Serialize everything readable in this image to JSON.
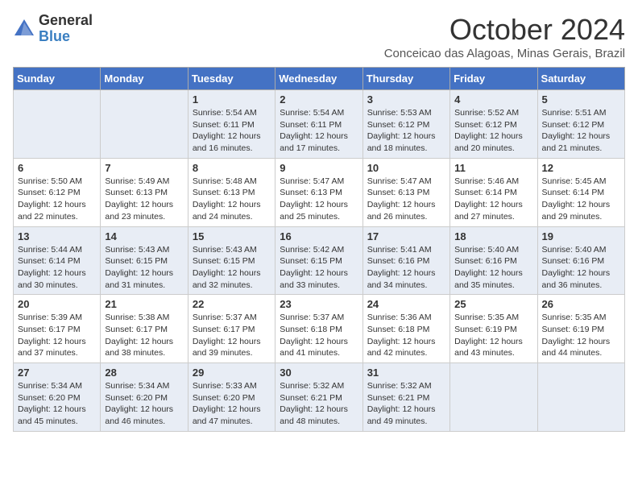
{
  "logo": {
    "general": "General",
    "blue": "Blue"
  },
  "title": "October 2024",
  "location": "Conceicao das Alagoas, Minas Gerais, Brazil",
  "days_of_week": [
    "Sunday",
    "Monday",
    "Tuesday",
    "Wednesday",
    "Thursday",
    "Friday",
    "Saturday"
  ],
  "weeks": [
    [
      {
        "day": "",
        "info": ""
      },
      {
        "day": "",
        "info": ""
      },
      {
        "day": "1",
        "info": "Sunrise: 5:54 AM\nSunset: 6:11 PM\nDaylight: 12 hours and 16 minutes."
      },
      {
        "day": "2",
        "info": "Sunrise: 5:54 AM\nSunset: 6:11 PM\nDaylight: 12 hours and 17 minutes."
      },
      {
        "day": "3",
        "info": "Sunrise: 5:53 AM\nSunset: 6:12 PM\nDaylight: 12 hours and 18 minutes."
      },
      {
        "day": "4",
        "info": "Sunrise: 5:52 AM\nSunset: 6:12 PM\nDaylight: 12 hours and 20 minutes."
      },
      {
        "day": "5",
        "info": "Sunrise: 5:51 AM\nSunset: 6:12 PM\nDaylight: 12 hours and 21 minutes."
      }
    ],
    [
      {
        "day": "6",
        "info": "Sunrise: 5:50 AM\nSunset: 6:12 PM\nDaylight: 12 hours and 22 minutes."
      },
      {
        "day": "7",
        "info": "Sunrise: 5:49 AM\nSunset: 6:13 PM\nDaylight: 12 hours and 23 minutes."
      },
      {
        "day": "8",
        "info": "Sunrise: 5:48 AM\nSunset: 6:13 PM\nDaylight: 12 hours and 24 minutes."
      },
      {
        "day": "9",
        "info": "Sunrise: 5:47 AM\nSunset: 6:13 PM\nDaylight: 12 hours and 25 minutes."
      },
      {
        "day": "10",
        "info": "Sunrise: 5:47 AM\nSunset: 6:13 PM\nDaylight: 12 hours and 26 minutes."
      },
      {
        "day": "11",
        "info": "Sunrise: 5:46 AM\nSunset: 6:14 PM\nDaylight: 12 hours and 27 minutes."
      },
      {
        "day": "12",
        "info": "Sunrise: 5:45 AM\nSunset: 6:14 PM\nDaylight: 12 hours and 29 minutes."
      }
    ],
    [
      {
        "day": "13",
        "info": "Sunrise: 5:44 AM\nSunset: 6:14 PM\nDaylight: 12 hours and 30 minutes."
      },
      {
        "day": "14",
        "info": "Sunrise: 5:43 AM\nSunset: 6:15 PM\nDaylight: 12 hours and 31 minutes."
      },
      {
        "day": "15",
        "info": "Sunrise: 5:43 AM\nSunset: 6:15 PM\nDaylight: 12 hours and 32 minutes."
      },
      {
        "day": "16",
        "info": "Sunrise: 5:42 AM\nSunset: 6:15 PM\nDaylight: 12 hours and 33 minutes."
      },
      {
        "day": "17",
        "info": "Sunrise: 5:41 AM\nSunset: 6:16 PM\nDaylight: 12 hours and 34 minutes."
      },
      {
        "day": "18",
        "info": "Sunrise: 5:40 AM\nSunset: 6:16 PM\nDaylight: 12 hours and 35 minutes."
      },
      {
        "day": "19",
        "info": "Sunrise: 5:40 AM\nSunset: 6:16 PM\nDaylight: 12 hours and 36 minutes."
      }
    ],
    [
      {
        "day": "20",
        "info": "Sunrise: 5:39 AM\nSunset: 6:17 PM\nDaylight: 12 hours and 37 minutes."
      },
      {
        "day": "21",
        "info": "Sunrise: 5:38 AM\nSunset: 6:17 PM\nDaylight: 12 hours and 38 minutes."
      },
      {
        "day": "22",
        "info": "Sunrise: 5:37 AM\nSunset: 6:17 PM\nDaylight: 12 hours and 39 minutes."
      },
      {
        "day": "23",
        "info": "Sunrise: 5:37 AM\nSunset: 6:18 PM\nDaylight: 12 hours and 41 minutes."
      },
      {
        "day": "24",
        "info": "Sunrise: 5:36 AM\nSunset: 6:18 PM\nDaylight: 12 hours and 42 minutes."
      },
      {
        "day": "25",
        "info": "Sunrise: 5:35 AM\nSunset: 6:19 PM\nDaylight: 12 hours and 43 minutes."
      },
      {
        "day": "26",
        "info": "Sunrise: 5:35 AM\nSunset: 6:19 PM\nDaylight: 12 hours and 44 minutes."
      }
    ],
    [
      {
        "day": "27",
        "info": "Sunrise: 5:34 AM\nSunset: 6:20 PM\nDaylight: 12 hours and 45 minutes."
      },
      {
        "day": "28",
        "info": "Sunrise: 5:34 AM\nSunset: 6:20 PM\nDaylight: 12 hours and 46 minutes."
      },
      {
        "day": "29",
        "info": "Sunrise: 5:33 AM\nSunset: 6:20 PM\nDaylight: 12 hours and 47 minutes."
      },
      {
        "day": "30",
        "info": "Sunrise: 5:32 AM\nSunset: 6:21 PM\nDaylight: 12 hours and 48 minutes."
      },
      {
        "day": "31",
        "info": "Sunrise: 5:32 AM\nSunset: 6:21 PM\nDaylight: 12 hours and 49 minutes."
      },
      {
        "day": "",
        "info": ""
      },
      {
        "day": "",
        "info": ""
      }
    ]
  ]
}
